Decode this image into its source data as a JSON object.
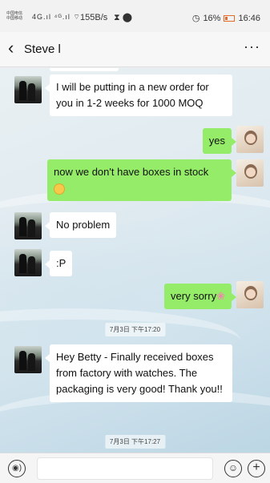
{
  "status_bar": {
    "carrier_line1": "中国电信",
    "carrier_line2": "中国移动",
    "signals": "4G.ıl ⁴ᴳ.ıl ⌔",
    "speed": "155B/s",
    "status_icons": "⧗ ⬤",
    "alarm": "◷",
    "battery": "16%",
    "time": "16:46"
  },
  "header": {
    "back_glyph": "‹",
    "title": "Steve l",
    "more_glyph": "···"
  },
  "messages": [
    {
      "side": "left",
      "text": "I will be putting in a new order for you in 1-2 weeks for 1000 MOQ"
    },
    {
      "side": "right",
      "text": "yes"
    },
    {
      "side": "right",
      "text": "now we don't have boxes in stock"
    },
    {
      "side": "left",
      "text": "No problem"
    },
    {
      "side": "left",
      "text": ":P"
    },
    {
      "side": "right",
      "text": "very sorry"
    },
    {
      "side": "left",
      "text": "Hey Betty - Finally received boxes from factory with watches. The packaging is very good! Thank you!!"
    }
  ],
  "timestamps": [
    "7月3日 下午17:20",
    "7月3日 下午17:27"
  ],
  "input": {
    "value": "",
    "voice_glyph": "◉)",
    "emoji_glyph": "☺",
    "plus_glyph": "+"
  },
  "icons": {
    "flower": "❀"
  }
}
